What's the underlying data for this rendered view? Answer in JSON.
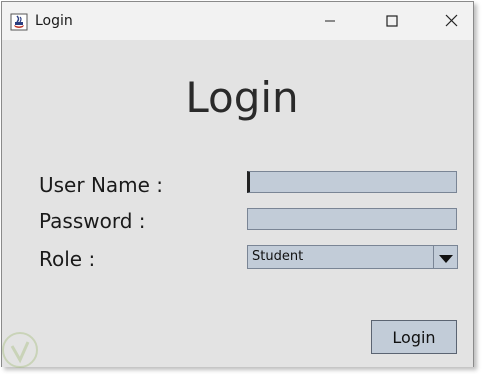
{
  "window": {
    "title": "Login",
    "app_icon": "java-cup-icon",
    "controls": {
      "minimize_icon": "minimize-icon",
      "maximize_icon": "maximize-icon",
      "close_icon": "close-icon"
    }
  },
  "form": {
    "heading": "Login",
    "username_label": "User Name :",
    "username_value": "",
    "password_label": "Password :",
    "password_value": "",
    "role_label": "Role :",
    "role_selected": "Student",
    "submit_label": "Login"
  },
  "colors": {
    "background": "#e3e3e3",
    "titlebar": "#f2f2f2",
    "field_fill": "#c2ccd8"
  }
}
